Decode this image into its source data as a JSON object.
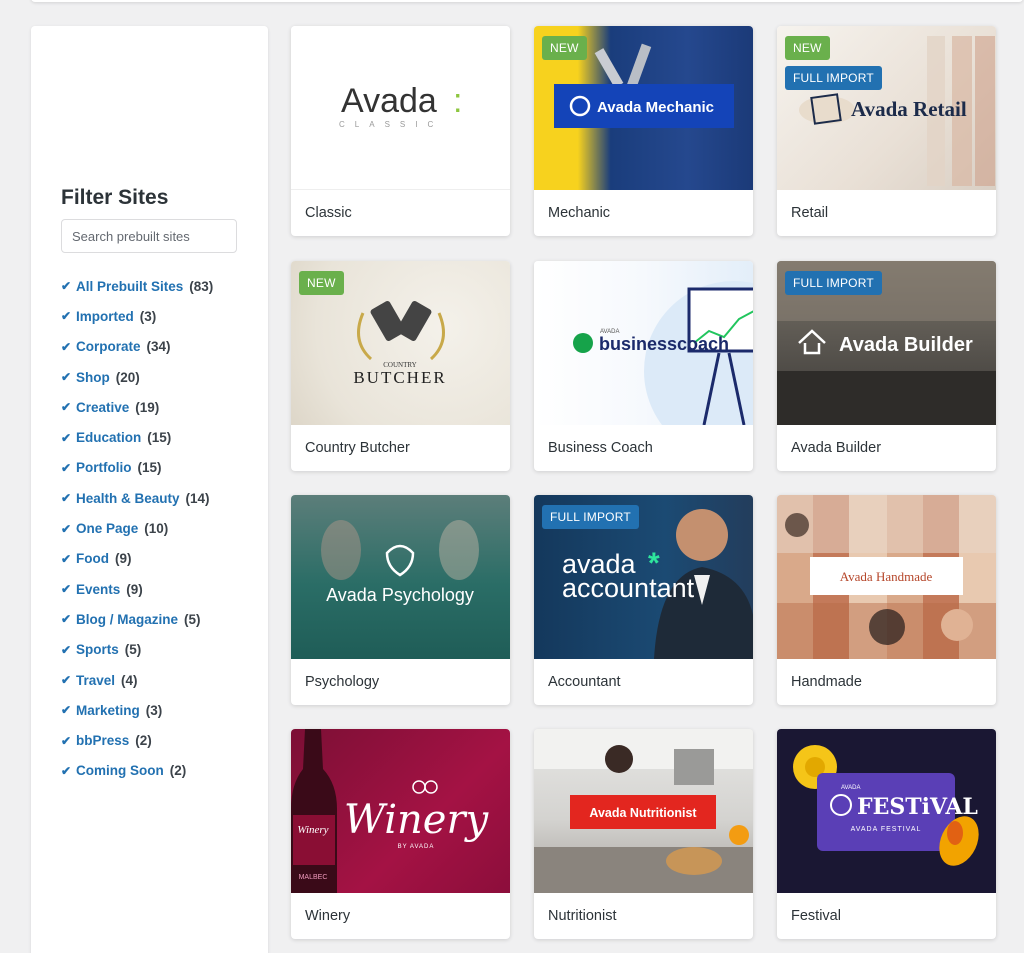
{
  "sidebar": {
    "title": "Filter Sites",
    "search_placeholder": "Search prebuilt sites",
    "filters": [
      {
        "label": "All Prebuilt Sites",
        "count": "(83)"
      },
      {
        "label": "Imported",
        "count": "(3)"
      },
      {
        "label": "Corporate",
        "count": "(34)"
      },
      {
        "label": "Shop",
        "count": "(20)"
      },
      {
        "label": "Creative",
        "count": "(19)"
      },
      {
        "label": "Education",
        "count": "(15)"
      },
      {
        "label": "Portfolio",
        "count": "(15)"
      },
      {
        "label": "Health & Beauty",
        "count": "(14)"
      },
      {
        "label": "One Page",
        "count": "(10)"
      },
      {
        "label": "Food",
        "count": "(9)"
      },
      {
        "label": "Events",
        "count": "(9)"
      },
      {
        "label": "Blog / Magazine",
        "count": "(5)"
      },
      {
        "label": "Sports",
        "count": "(5)"
      },
      {
        "label": "Travel",
        "count": "(4)"
      },
      {
        "label": "Marketing",
        "count": "(3)"
      },
      {
        "label": "bbPress",
        "count": "(2)"
      },
      {
        "label": "Coming Soon",
        "count": "(2)"
      }
    ]
  },
  "badges": {
    "new": "NEW",
    "full_import": "FULL IMPORT"
  },
  "sites": [
    {
      "name": "Classic",
      "logo_main": "Avada",
      "logo_colon": ":",
      "logo_sub": "CLASSIC"
    },
    {
      "name": "Mechanic",
      "logo": "Avada Mechanic"
    },
    {
      "name": "Retail",
      "logo": "Avada Retail"
    },
    {
      "name": "Country Butcher",
      "logo_top": "COUNTRY",
      "logo": "BUTCHER"
    },
    {
      "name": "Business Coach",
      "logo_top": "AVADA",
      "logo": "businesscoach"
    },
    {
      "name": "Avada Builder",
      "logo": "Avada Builder"
    },
    {
      "name": "Psychology",
      "logo": "Avada Psychology"
    },
    {
      "name": "Accountant",
      "logo_line1": "avada",
      "logo_star": "*",
      "logo_line2": "accountant"
    },
    {
      "name": "Handmade",
      "logo": "Avada Handmade"
    },
    {
      "name": "Winery",
      "logo": "Winery",
      "logo_sub": "BY AVADA",
      "bottle_label": "Winery",
      "bottle_sub": "MALBEC"
    },
    {
      "name": "Nutritionist",
      "logo": "Avada Nutritionist"
    },
    {
      "name": "Festival",
      "logo_top": "AVADA",
      "logo": "FESTiVAL",
      "logo_sub": "AVADA FESTIVAL"
    }
  ],
  "colors": {
    "accent": "#2271b1",
    "new_badge": "#6ab04c",
    "full_badge": "#2271b1"
  }
}
